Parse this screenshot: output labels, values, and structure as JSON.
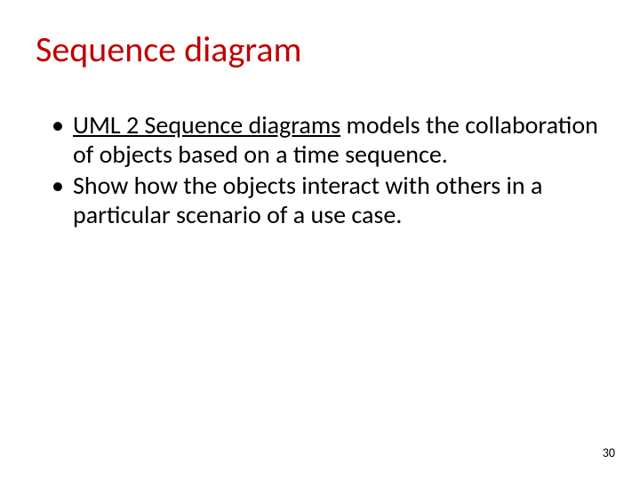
{
  "colors": {
    "title": "#c00000"
  },
  "title": "Sequence diagram",
  "bullets": [
    {
      "link_text": "UML 2 Sequence diagrams",
      "rest": " models the collaboration of objects based on a time sequence."
    },
    {
      "link_text": "",
      "rest": "Show how the objects interact with others in a particular scenario of a use case."
    }
  ],
  "page_number": "30",
  "bullet_char": "•"
}
